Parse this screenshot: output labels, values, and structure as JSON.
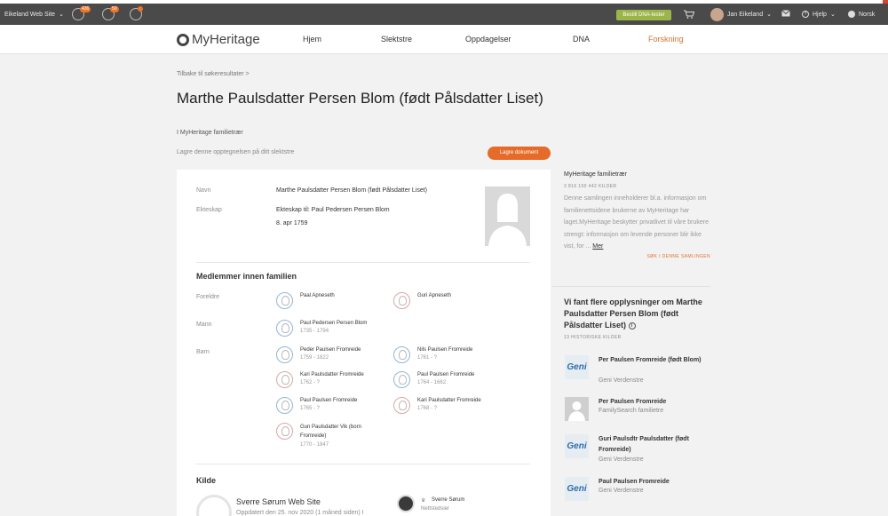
{
  "topbar": {
    "site": "Eikeland Web Site",
    "badge1": "436",
    "badge2": "50",
    "dna_button": "Bestill DNA-tester",
    "user": "Jan Eikeland",
    "help": "Hjelp",
    "language": "Norsk"
  },
  "nav": {
    "logo": "MyHeritage",
    "items": [
      "Hjem",
      "Slektstre",
      "Oppdagelser",
      "DNA",
      "Forskning"
    ]
  },
  "page": {
    "back": "Tilbake til søkeresultater >",
    "title": "Marthe Paulsdatter Persen Blom (født Pålsdatter Liset)",
    "subtitle": "I MyHeritage familietrær",
    "save_text": "Lagre denne opptegnelsen på ditt slektstre",
    "save_button": "Lagre dokument"
  },
  "record": {
    "name_label": "Navn",
    "name_value": "Marthe Paulsdatter Persen Blom (født Pålsdatter Liset)",
    "spouse_label": "Ekteskap",
    "spouse_value": "Ekteskap til: Paul Pedersen Persen Blom",
    "spouse_date": "8. apr 1759"
  },
  "family": {
    "title": "Medlemmer innen familien",
    "parents_label": "Foreldre",
    "husband_label": "Mann",
    "children_label": "Barn",
    "parents": [
      {
        "name": "Paal Apneseth",
        "date": ""
      },
      {
        "name": "Guri Apneseth",
        "date": ""
      }
    ],
    "husband": {
      "name": "Paul Pedersen Persen Blom",
      "date": "1735 - 1794"
    },
    "children": [
      {
        "name": "Peder Paulsen Fromreide",
        "date": "1759 - 1822"
      },
      {
        "name": "Nils Paulsen Fromreide",
        "date": "1761 - ?"
      },
      {
        "name": "Kari Paulsdatter Fromreide",
        "date": "1762 - ?"
      },
      {
        "name": "Paul Paulsen Fromreide",
        "date": "1764 - 1662"
      },
      {
        "name": "Paul Paulsen Fromreide",
        "date": "1765 - ?"
      },
      {
        "name": "Kari Paulsdatter Fromreide",
        "date": "1768 - ?"
      },
      {
        "name": "Gun Paulsdatter Vik (born Fromreide)",
        "date": "1770 - 1847"
      }
    ]
  },
  "source": {
    "title": "Kilde",
    "site": "Sverre Sørum Web Site",
    "updated": "Oppdatert den 25. nov 2020 (1 måned siden) I",
    "owner": "Sverre Sørum",
    "owner_role": "Nettstedsier"
  },
  "sidebar": {
    "collection_title": "MyHeritage familietrær",
    "collection_count": "3 816 150 442 KILDER",
    "collection_desc": "Denne samlingen inneholderer bl.a. informasjon om familienettsidene brukerne av MyHeritage har laget.MyHeritage beskytter privatlivet til våre brukere strengt: informasjon om levende personer blir ikke vist, for ...",
    "more_link": "Mer",
    "search_link": "SØK I DENNE SAMLINGEN",
    "more_title": "Vi fant flere opplysninger om Marthe Paulsdatter Persen Blom (født Pålsdatter Liset)",
    "more_count": "13 HISTORISKE KILDER",
    "records": [
      {
        "name": "Per Paulsen Fromreide (født Blom)",
        "source": "Geni Verdenstre",
        "logo": "Geni"
      },
      {
        "name": "Per Paulsen Fromreide",
        "source": "FamilySearch familietre",
        "logo": ""
      },
      {
        "name": "Guri Paulsdtr Paulsdatter (født Fromreide)",
        "source": "Geni Verdenstre",
        "logo": "Geni"
      },
      {
        "name": "Paul Paulsen Fromreide",
        "source": "Geni Verdenstre",
        "logo": "Geni"
      }
    ]
  }
}
